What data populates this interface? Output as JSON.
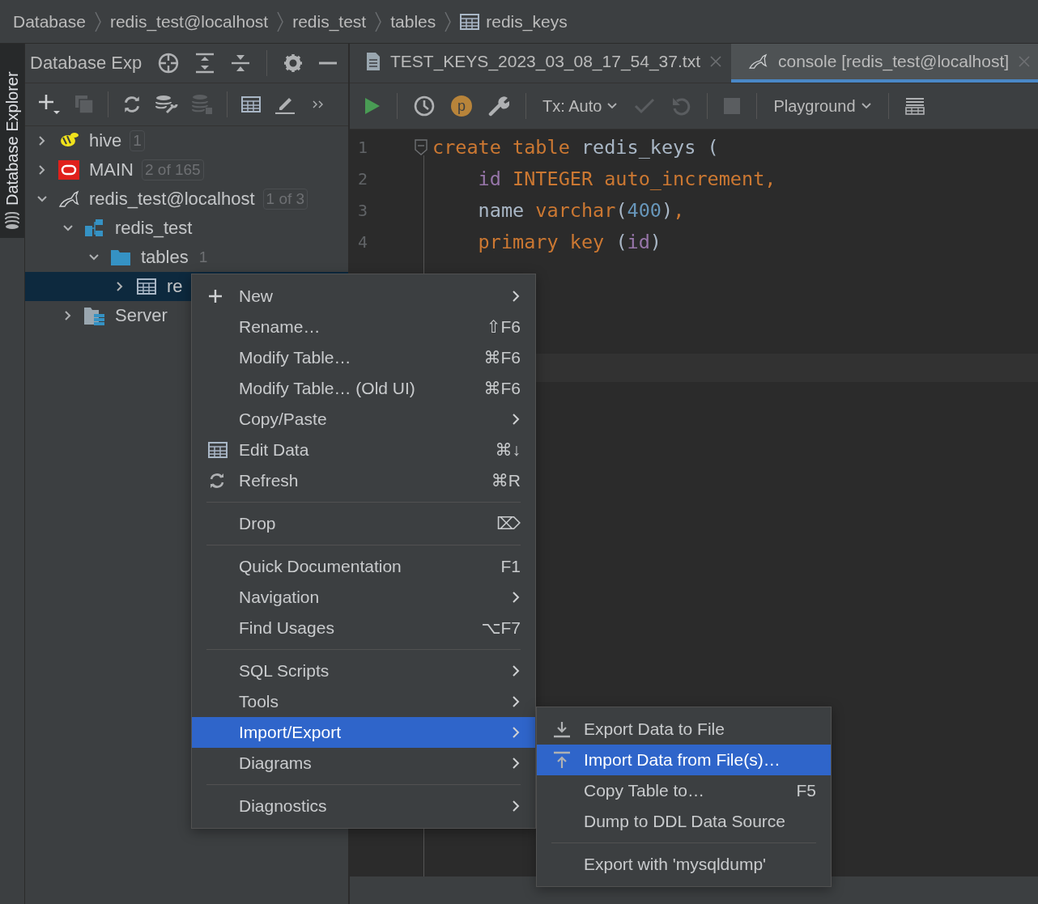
{
  "breadcrumbs": [
    {
      "label": "Database",
      "kind": "plain"
    },
    {
      "label": "redis_test@localhost",
      "kind": "plain"
    },
    {
      "label": "redis_test",
      "kind": "plain"
    },
    {
      "label": "tables",
      "kind": "plain"
    },
    {
      "label": "redis_keys",
      "kind": "table"
    }
  ],
  "side_stripe": {
    "tab": {
      "label": "Database Explorer",
      "selected": true
    }
  },
  "explorer": {
    "title": "Database Exp",
    "tree": [
      {
        "label": "hive",
        "kind": "hive",
        "expanded": false,
        "count": "1",
        "count_boxed": true,
        "selected": false
      },
      {
        "label": "MAIN",
        "kind": "oracle",
        "expanded": false,
        "count": "2 of 165",
        "count_boxed": true,
        "selected": false
      },
      {
        "label": "redis_test@localhost",
        "kind": "mysql",
        "expanded": true,
        "count": "1 of 3",
        "count_boxed": true,
        "selected": false,
        "children": [
          {
            "label": "redis_test",
            "kind": "schema",
            "expanded": true,
            "selected": false,
            "children": [
              {
                "label": "tables",
                "kind": "folder",
                "expanded": true,
                "count": "1",
                "count_boxed": false,
                "selected": false,
                "children": [
                  {
                    "label": "re",
                    "kind": "table",
                    "expanded": false,
                    "selected": true
                  }
                ]
              }
            ]
          },
          {
            "label": "Server",
            "kind": "objects",
            "expanded": false,
            "selected": false
          }
        ]
      }
    ]
  },
  "editor": {
    "tabs": [
      {
        "label": "TEST_KEYS_2023_03_08_17_54_37.txt",
        "kind": "file",
        "selected": false
      },
      {
        "label": "console [redis_test@localhost]",
        "kind": "console",
        "selected": true
      }
    ],
    "toolbar": {
      "profile_badge": "p",
      "transaction": "Tx: Auto",
      "mode": "Playground"
    },
    "lines": [
      {
        "number": "1",
        "tokens": [
          {
            "text": "create table",
            "kind": "keyword"
          },
          {
            "text": " redis_keys (",
            "kind": "plain"
          }
        ]
      },
      {
        "number": "2",
        "tokens": [
          {
            "text": "    id",
            "kind": "field"
          },
          {
            "text": " INTEGER auto_increment,",
            "kind": "keyword"
          }
        ]
      },
      {
        "number": "3",
        "tokens": [
          {
            "text": "    name ",
            "kind": "plain"
          },
          {
            "text": "varchar",
            "kind": "keyword"
          },
          {
            "text": "(",
            "kind": "plain"
          },
          {
            "text": "400",
            "kind": "number"
          },
          {
            "text": ")",
            "kind": "plain"
          },
          {
            "text": ",",
            "kind": "keyword"
          }
        ]
      },
      {
        "number": "4",
        "tokens": [
          {
            "text": "    primary key",
            "kind": "keyword"
          },
          {
            "text": " (",
            "kind": "plain"
          },
          {
            "text": "id",
            "kind": "field"
          },
          {
            "text": ")",
            "kind": "plain"
          }
        ]
      }
    ]
  },
  "context_menu": {
    "items": [
      {
        "kind": "item",
        "label": "New",
        "submenu": true,
        "selected": false
      },
      {
        "kind": "item",
        "label": "Rename…",
        "shortcut": "⇧F6",
        "submenu": false,
        "selected": false
      },
      {
        "kind": "item",
        "label": "Modify Table…",
        "shortcut": "⌘F6",
        "submenu": false,
        "selected": false
      },
      {
        "kind": "item",
        "label": "Modify Table… (Old UI)",
        "shortcut": "⌘F6",
        "submenu": false,
        "selected": false
      },
      {
        "kind": "item",
        "label": "Copy/Paste",
        "submenu": true,
        "selected": false
      },
      {
        "kind": "item",
        "label": "Edit Data",
        "shortcut": "⌘↓",
        "submenu": false,
        "selected": false
      },
      {
        "kind": "item",
        "label": "Refresh",
        "shortcut": "⌘R",
        "submenu": false,
        "selected": false
      },
      {
        "kind": "separator"
      },
      {
        "kind": "item",
        "label": "Drop",
        "shortcut": "⌦",
        "submenu": false,
        "selected": false
      },
      {
        "kind": "separator"
      },
      {
        "kind": "item",
        "label": "Quick Documentation",
        "shortcut": "F1",
        "submenu": false,
        "selected": false
      },
      {
        "kind": "item",
        "label": "Navigation",
        "submenu": true,
        "selected": false
      },
      {
        "kind": "item",
        "label": "Find Usages",
        "shortcut": "⌥F7",
        "submenu": false,
        "selected": false
      },
      {
        "kind": "separator"
      },
      {
        "kind": "item",
        "label": "SQL Scripts",
        "submenu": true,
        "selected": false
      },
      {
        "kind": "item",
        "label": "Tools",
        "submenu": true,
        "selected": false
      },
      {
        "kind": "item",
        "label": "Import/Export",
        "submenu": true,
        "selected": true
      },
      {
        "kind": "item",
        "label": "Diagrams",
        "submenu": true,
        "selected": false
      },
      {
        "kind": "separator"
      },
      {
        "kind": "item",
        "label": "Diagnostics",
        "submenu": true,
        "selected": false
      }
    ]
  },
  "submenu": {
    "items": [
      {
        "kind": "item",
        "label": "Export Data to File",
        "submenu": false,
        "selected": false
      },
      {
        "kind": "item",
        "label": "Import Data from File(s)…",
        "submenu": false,
        "selected": true
      },
      {
        "kind": "item",
        "label": "Copy Table to…",
        "shortcut": "F5",
        "submenu": false,
        "selected": false
      },
      {
        "kind": "item",
        "label": "Dump to DDL Data Source",
        "submenu": false,
        "selected": false
      },
      {
        "kind": "separator"
      },
      {
        "kind": "item",
        "label": "Export with 'mysqldump'",
        "submenu": false,
        "selected": false
      }
    ]
  }
}
